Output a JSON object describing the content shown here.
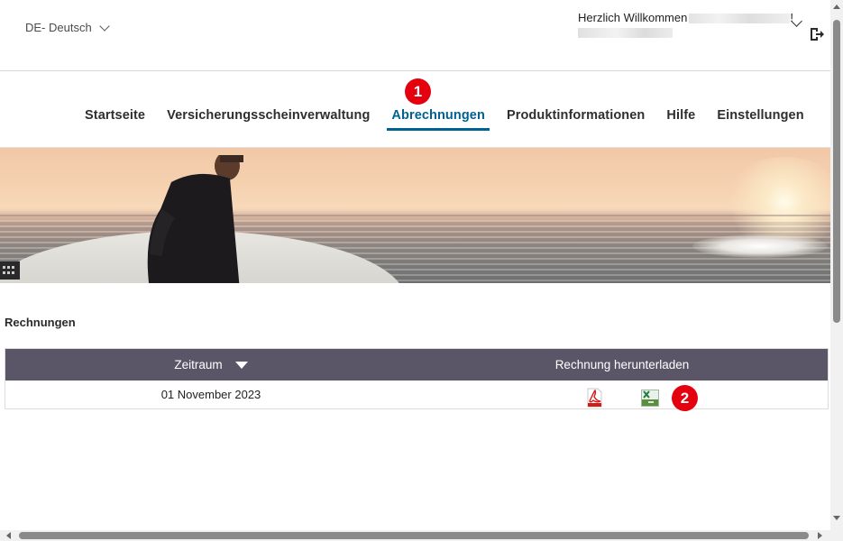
{
  "header": {
    "language": "DE- Deutsch",
    "welcome": "Herzlich Willkommen",
    "welcome_suffix": "!"
  },
  "nav": {
    "items": [
      {
        "label": "Startseite"
      },
      {
        "label": "Versicherungsscheinverwaltung"
      },
      {
        "label": "Abrechnungen"
      },
      {
        "label": "Produktinformationen"
      },
      {
        "label": "Hilfe"
      },
      {
        "label": "Einstellungen"
      }
    ],
    "active_index": 2
  },
  "annotations": {
    "badge1": "1",
    "badge2": "2"
  },
  "section": {
    "title": "Rechnungen"
  },
  "table": {
    "columns": [
      "Zeitraum",
      "Rechnung herunterladen"
    ],
    "rows": [
      {
        "period": "01 November 2023",
        "downloads": [
          "pdf-icon",
          "xls-icon"
        ]
      }
    ]
  },
  "colors": {
    "accent": "#006192",
    "table_header": "#5b5667",
    "badge": "#e4000f",
    "pdf": "#d51a1a",
    "xls": "#1f7a3c"
  }
}
